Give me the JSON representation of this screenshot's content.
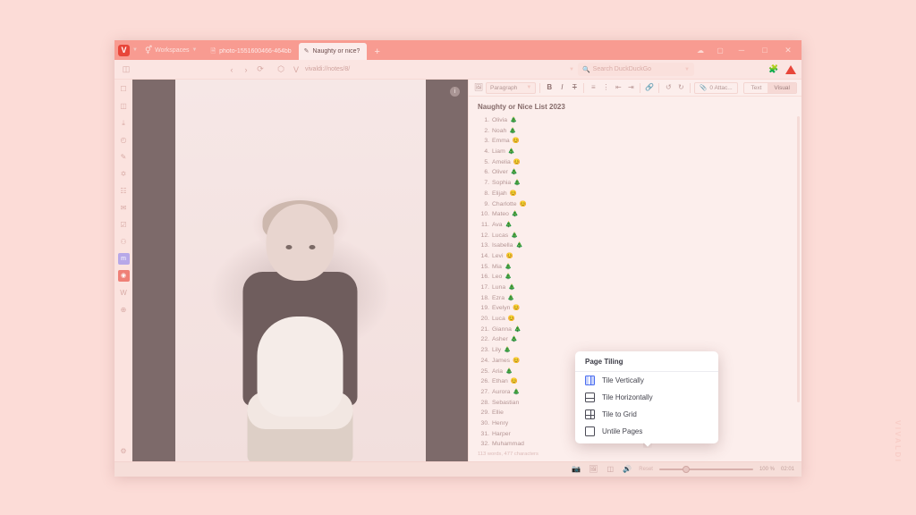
{
  "window": {
    "tabbar": {
      "vivaldi_menu_label": "V",
      "workspaces_label": "Workspaces",
      "tabs": [
        {
          "label": "photo-1551600466-464bb",
          "favicon": "document-icon",
          "active": false
        },
        {
          "label": "Naughty or nice?",
          "favicon": "note-icon",
          "active": true
        }
      ],
      "new_tab_label": "+",
      "window_controls": {
        "sync": "☁",
        "panel": "▢",
        "minimize": "─",
        "maximize": "□",
        "close": "✕"
      }
    },
    "addressbar": {
      "panel_toggle": "panel-toggle-icon",
      "back": "‹",
      "forward": "›",
      "reload": "⟳",
      "shield": "⬡",
      "site_icon": "V",
      "url": "vivaldi://notes/8/",
      "search_placeholder": "Search DuckDuckGo",
      "extensions_icon": "puzzle-icon",
      "vivaldi_menu_icon": "vivaldi-triangle-icon"
    },
    "panelbar": {
      "items": [
        {
          "name": "bookmarks",
          "glyph": "☐"
        },
        {
          "name": "reading-list",
          "glyph": "◫"
        },
        {
          "name": "downloads",
          "glyph": "⤓"
        },
        {
          "name": "history",
          "glyph": "◴"
        },
        {
          "name": "notes",
          "glyph": "✎"
        },
        {
          "name": "translate",
          "glyph": "✡"
        },
        {
          "name": "calendar",
          "glyph": "☷"
        },
        {
          "name": "mail",
          "glyph": "✉"
        },
        {
          "name": "tasks",
          "glyph": "☑"
        },
        {
          "name": "feeds",
          "glyph": "⚇"
        },
        {
          "name": "mastodon",
          "glyph": "m"
        },
        {
          "name": "vivaldi-social",
          "glyph": "◉"
        },
        {
          "name": "wikipedia",
          "glyph": "W"
        },
        {
          "name": "add-web-panel",
          "glyph": "⊕"
        }
      ],
      "bottom": [
        {
          "name": "settings",
          "glyph": "⚙"
        }
      ]
    }
  },
  "photo_tile": {
    "badge": "i"
  },
  "notes": {
    "toolbar": {
      "insert_image": "image-icon",
      "paragraph_label": "Paragraph",
      "bold": "B",
      "italic": "I",
      "strikethrough": "T",
      "ordered_list": "list-ordered-icon",
      "bullet_list": "list-bullet-icon",
      "outdent": "outdent-icon",
      "indent": "indent-icon",
      "link": "link-icon",
      "undo": "↺",
      "redo": "↻",
      "attachments_label": "0 Attac...",
      "mode_text": "Text",
      "mode_visual": "Visual"
    },
    "title": "Naughty or Nice List 2023",
    "items": [
      {
        "n": "1.",
        "name": "Olivia",
        "mark": "tree"
      },
      {
        "n": "2.",
        "name": "Noah",
        "mark": "tree"
      },
      {
        "n": "3.",
        "name": "Emma",
        "mark": "face"
      },
      {
        "n": "4.",
        "name": "Liam",
        "mark": "tree"
      },
      {
        "n": "5.",
        "name": "Amelia",
        "mark": "face"
      },
      {
        "n": "6.",
        "name": "Oliver",
        "mark": "tree"
      },
      {
        "n": "7.",
        "name": "Sophia",
        "mark": "tree"
      },
      {
        "n": "8.",
        "name": "Elijah",
        "mark": "face"
      },
      {
        "n": "9.",
        "name": "Charlotte",
        "mark": "face"
      },
      {
        "n": "10.",
        "name": "Mateo",
        "mark": "tree"
      },
      {
        "n": "11.",
        "name": "Ava",
        "mark": "tree"
      },
      {
        "n": "12.",
        "name": "Lucas",
        "mark": "tree"
      },
      {
        "n": "13.",
        "name": "Isabella",
        "mark": "tree"
      },
      {
        "n": "14.",
        "name": "Levi",
        "mark": "face"
      },
      {
        "n": "15.",
        "name": "Mia",
        "mark": "tree"
      },
      {
        "n": "16.",
        "name": "Leo",
        "mark": "tree"
      },
      {
        "n": "17.",
        "name": "Luna",
        "mark": "tree"
      },
      {
        "n": "18.",
        "name": "Ezra",
        "mark": "tree"
      },
      {
        "n": "19.",
        "name": "Evelyn",
        "mark": "face"
      },
      {
        "n": "20.",
        "name": "Luca",
        "mark": "face"
      },
      {
        "n": "21.",
        "name": "Gianna",
        "mark": "tree"
      },
      {
        "n": "22.",
        "name": "Asher",
        "mark": "tree"
      },
      {
        "n": "23.",
        "name": "Lily",
        "mark": "tree"
      },
      {
        "n": "24.",
        "name": "James",
        "mark": "face"
      },
      {
        "n": "25.",
        "name": "Aria",
        "mark": "tree"
      },
      {
        "n": "26.",
        "name": "Ethan",
        "mark": "face"
      },
      {
        "n": "27.",
        "name": "Aurora",
        "mark": "tree"
      },
      {
        "n": "28.",
        "name": "Sebastian",
        "mark": ""
      },
      {
        "n": "29.",
        "name": "Ellie",
        "mark": ""
      },
      {
        "n": "30.",
        "name": "Henry",
        "mark": ""
      },
      {
        "n": "31.",
        "name": "Harper",
        "mark": ""
      },
      {
        "n": "32.",
        "name": "Muhammad",
        "mark": ""
      }
    ],
    "footer": "113 words, 477 characters"
  },
  "statusbar": {
    "capture_icon": "camera-icon",
    "image_toggle_icon": "image-toggle-icon",
    "tiling_icon": "tiling-icon",
    "mute_icon": "sound-icon",
    "reset_label": "Reset",
    "zoom_value": "100 %",
    "clock": "02:01"
  },
  "tiling_menu": {
    "title": "Page Tiling",
    "items": [
      {
        "label": "Tile Vertically",
        "icon": "tile-vertical-icon",
        "selected": true
      },
      {
        "label": "Tile Horizontally",
        "icon": "tile-horizontal-icon",
        "selected": false
      },
      {
        "label": "Tile to Grid",
        "icon": "tile-grid-icon",
        "selected": false
      },
      {
        "label": "Untile Pages",
        "icon": "untile-icon",
        "selected": false
      }
    ]
  },
  "watermark": "VIVALDI",
  "colors": {
    "accent": "#f89b91",
    "vivaldi_red": "#e8463a",
    "tiling_blue": "#4a6df0"
  }
}
